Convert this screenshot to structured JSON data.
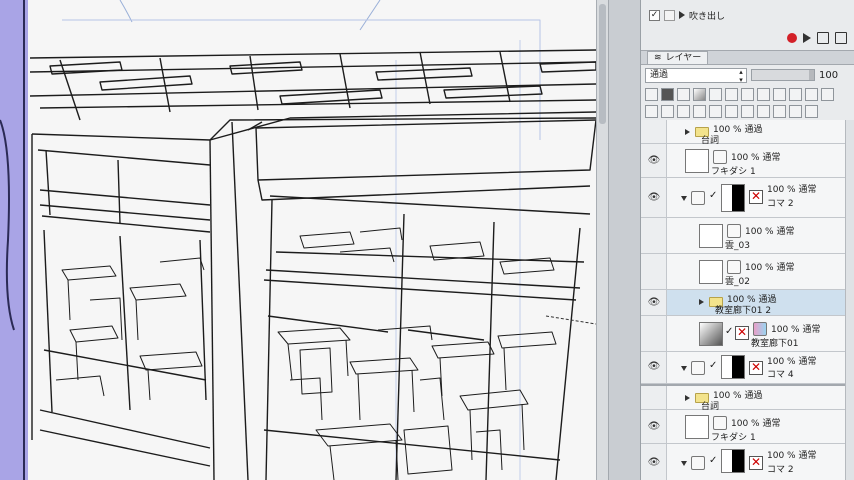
{
  "app": {
    "panel_tab_layers": "レイヤー"
  },
  "top_item": {
    "label": "吹き出し"
  },
  "blend": {
    "mode": "通過",
    "opacity": "100"
  },
  "layers": [
    {
      "id": "l1",
      "opacity_mode": "100 % 通過",
      "name": "台詞"
    },
    {
      "id": "l2",
      "opacity_mode": "100 % 通常",
      "name": "フキダシ 1"
    },
    {
      "id": "l3",
      "opacity_mode": "100 % 通常",
      "name": "コマ 2"
    },
    {
      "id": "l4",
      "opacity_mode": "100 % 通常",
      "name": "雲_03"
    },
    {
      "id": "l5",
      "opacity_mode": "100 % 通常",
      "name": "雲_02"
    },
    {
      "id": "l6",
      "opacity_mode": "100 % 通過",
      "name": "教室廊下01 2"
    },
    {
      "id": "l7",
      "opacity_mode": "100 % 通常",
      "name": "教室廊下01"
    },
    {
      "id": "l8",
      "opacity_mode": "100 % 通常",
      "name": "コマ 4"
    }
  ],
  "layers2": [
    {
      "id": "m1",
      "opacity_mode": "100 % 通過",
      "name": "台詞"
    },
    {
      "id": "m2",
      "opacity_mode": "100 % 通常",
      "name": "フキダシ 1"
    },
    {
      "id": "m3",
      "opacity_mode": "100 % 通常",
      "name": "コマ 2"
    }
  ],
  "colors": {
    "canvas_strip": "#a9a4e6",
    "selected_layer": "#cfe0ee",
    "record_red": "#d32028"
  },
  "icons": [
    "eye-icon",
    "folder-icon",
    "record-icon",
    "play-icon",
    "trash-icon",
    "pen-icon",
    "lock-icon"
  ]
}
